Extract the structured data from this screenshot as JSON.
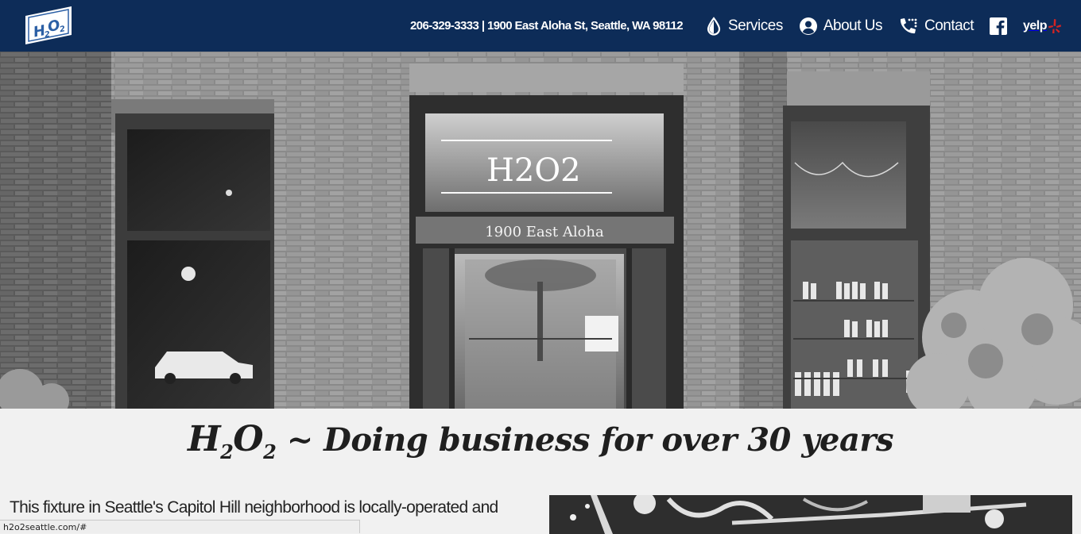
{
  "header": {
    "logo_text": "H2O2",
    "contact_info": "206-329-3333 | 1900 East Aloha St, Seattle, WA 98112",
    "nav": [
      {
        "label": "Services",
        "icon": "water-drop-icon"
      },
      {
        "label": "About Us",
        "icon": "user-circle-icon"
      },
      {
        "label": "Contact",
        "icon": "phone-icon"
      }
    ],
    "social": [
      {
        "icon": "facebook-icon"
      },
      {
        "label": "yelp",
        "icon": "yelp-icon"
      }
    ],
    "colors": {
      "bar": "#0d2c58",
      "text": "#ffffff",
      "yelp_red": "#d32323"
    }
  },
  "hero": {
    "window_sign": "H2O2",
    "address_sign": "1900 East Aloha"
  },
  "main": {
    "headline_mark": "H",
    "headline_sub1": "2",
    "headline_mark2": "O",
    "headline_sub2": "2",
    "headline_text": " ~ Doing business for over 30 years",
    "intro_text": "This fixture in Seattle's Capitol Hill neighborhood is locally-operated and"
  },
  "status_bar": {
    "url": "h2o2seattle.com/#"
  }
}
